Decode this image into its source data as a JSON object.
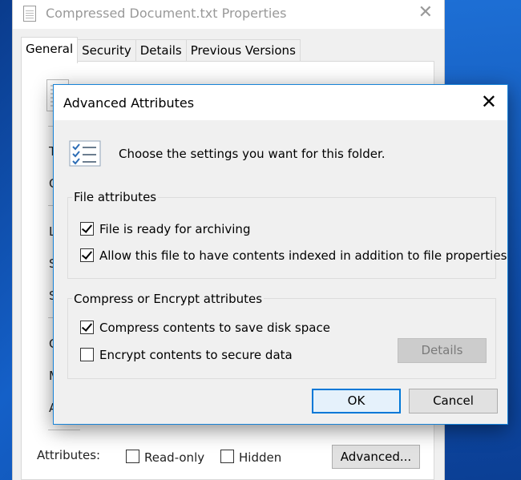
{
  "properties_window": {
    "title": "Compressed Document.txt Properties",
    "close_glyph": "✕",
    "title_icon": "text-file-icon",
    "tabs": [
      {
        "label": "General",
        "active": true
      },
      {
        "label": "Security",
        "active": false
      },
      {
        "label": "Details",
        "active": false
      },
      {
        "label": "Previous Versions",
        "active": false
      }
    ],
    "partial_labels": [
      "Typ",
      "Op",
      "Loc",
      "Siz",
      "Siz",
      "Cre",
      "Mo",
      "Acc"
    ],
    "attributes_label": "Attributes:",
    "read_only": {
      "label": "Read-only",
      "checked": false
    },
    "hidden": {
      "label": "Hidden",
      "checked": false
    },
    "advanced_button": "Advanced..."
  },
  "dialog": {
    "title": "Advanced Attributes",
    "close_glyph": "✕",
    "icon": "checklist-icon",
    "description": "Choose the settings you want for this folder.",
    "file_attributes": {
      "title": "File attributes",
      "options": [
        {
          "label": "File is ready for archiving",
          "checked": true
        },
        {
          "label": "Allow this file to have contents indexed in addition to file properties",
          "checked": true
        }
      ]
    },
    "compress_encrypt": {
      "title": "Compress or Encrypt attributes",
      "options": [
        {
          "label": "Compress contents to save disk space",
          "checked": true
        },
        {
          "label": "Encrypt contents to secure data",
          "checked": false
        }
      ],
      "details_button": "Details",
      "details_enabled": false
    },
    "ok_button": "OK",
    "cancel_button": "Cancel"
  },
  "colors": {
    "accent": "#0078d7",
    "desktop": "#1460c8",
    "dialog_bg": "#f0f0f0"
  }
}
